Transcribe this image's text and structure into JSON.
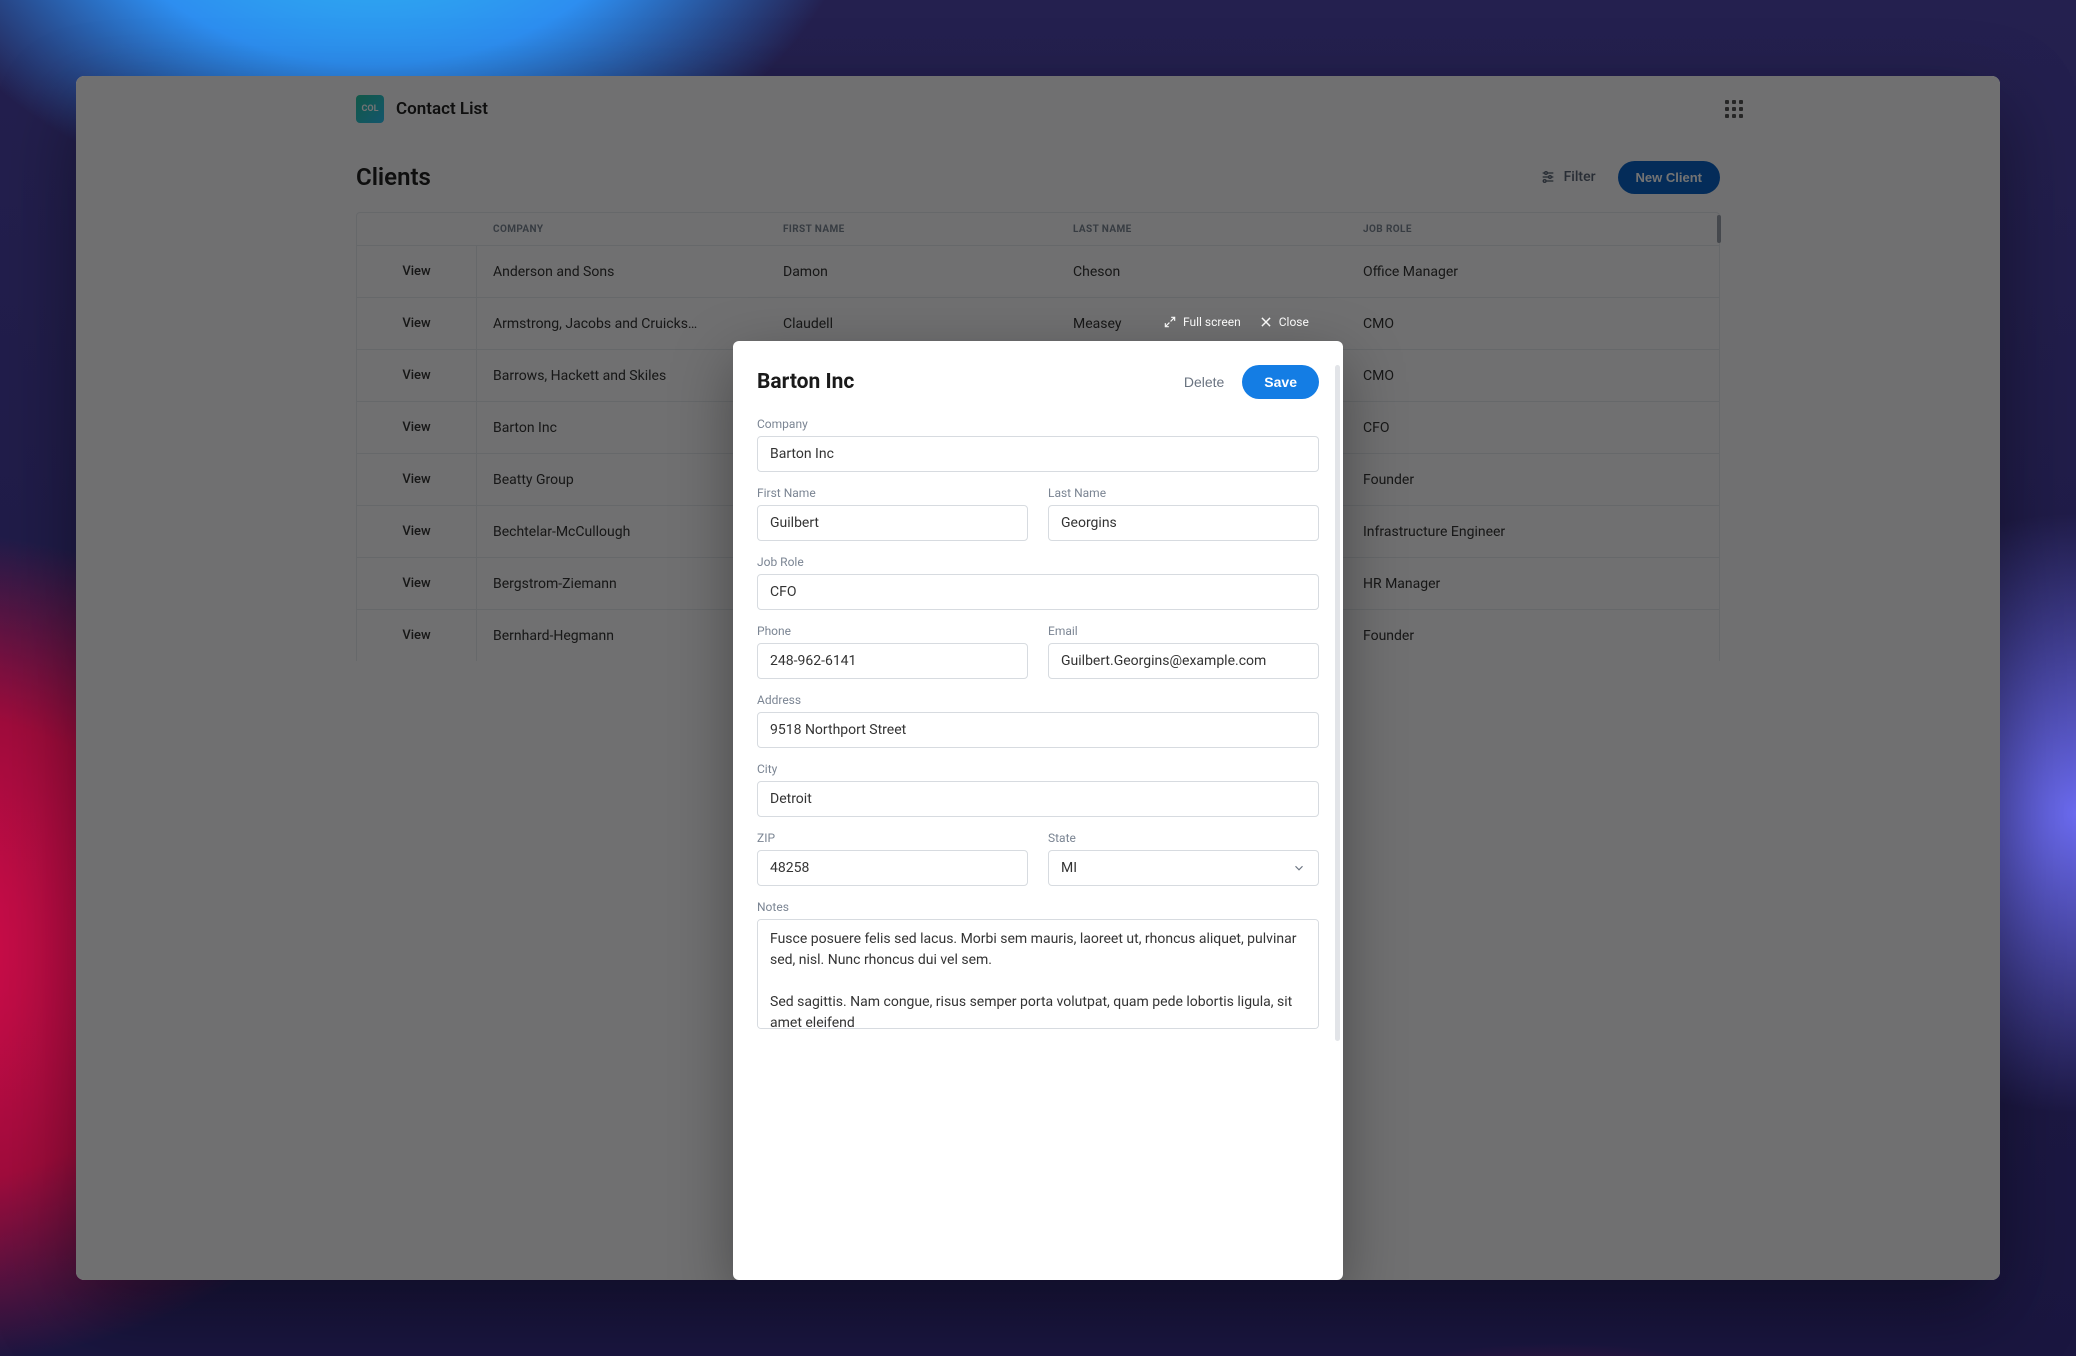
{
  "app": {
    "logo_text": "COL",
    "title": "Contact List"
  },
  "page": {
    "title": "Clients",
    "filter_label": "Filter",
    "new_button_label": "New Client"
  },
  "table": {
    "columns": {
      "company": "COMPANY",
      "first_name": "FIRST NAME",
      "last_name": "LAST NAME",
      "job_role": "JOB ROLE"
    },
    "view_label": "View",
    "rows": [
      {
        "company": "Anderson and Sons",
        "first_name": "Damon",
        "last_name": "Cheson",
        "job_role": "Office Manager"
      },
      {
        "company": "Armstrong, Jacobs and Cruicks…",
        "first_name": "Claudell",
        "last_name": "Measey",
        "job_role": "CMO"
      },
      {
        "company": "Barrows, Hackett and Skiles",
        "first_name": "",
        "last_name": "",
        "job_role": "CMO"
      },
      {
        "company": "Barton Inc",
        "first_name": "",
        "last_name": "",
        "job_role": "CFO"
      },
      {
        "company": "Beatty Group",
        "first_name": "",
        "last_name": "",
        "job_role": "Founder"
      },
      {
        "company": "Bechtelar-McCullough",
        "first_name": "",
        "last_name": "",
        "job_role": "Infrastructure Engineer"
      },
      {
        "company": "Bergstrom-Ziemann",
        "first_name": "",
        "last_name": "",
        "job_role": "HR Manager"
      },
      {
        "company": "Bernhard-Hegmann",
        "first_name": "",
        "last_name": "",
        "job_role": "Founder"
      }
    ]
  },
  "modal_controls": {
    "fullscreen": "Full screen",
    "close": "Close"
  },
  "modal": {
    "title": "Barton Inc",
    "delete_label": "Delete",
    "save_label": "Save",
    "labels": {
      "company": "Company",
      "first_name": "First Name",
      "last_name": "Last Name",
      "job_role": "Job Role",
      "phone": "Phone",
      "email": "Email",
      "address": "Address",
      "city": "City",
      "zip": "ZIP",
      "state": "State",
      "notes": "Notes"
    },
    "values": {
      "company": "Barton Inc",
      "first_name": "Guilbert",
      "last_name": "Georgins",
      "job_role": "CFO",
      "phone": "248-962-6141",
      "email": "Guilbert.Georgins@example.com",
      "address": "9518 Northport Street",
      "city": "Detroit",
      "zip": "48258",
      "state": "MI",
      "notes": "Fusce posuere felis sed lacus. Morbi sem mauris, laoreet ut, rhoncus aliquet, pulvinar sed, nisl. Nunc rhoncus dui vel sem.\n\nSed sagittis. Nam congue, risus semper porta volutpat, quam pede lobortis ligula, sit amet eleifend"
    }
  }
}
